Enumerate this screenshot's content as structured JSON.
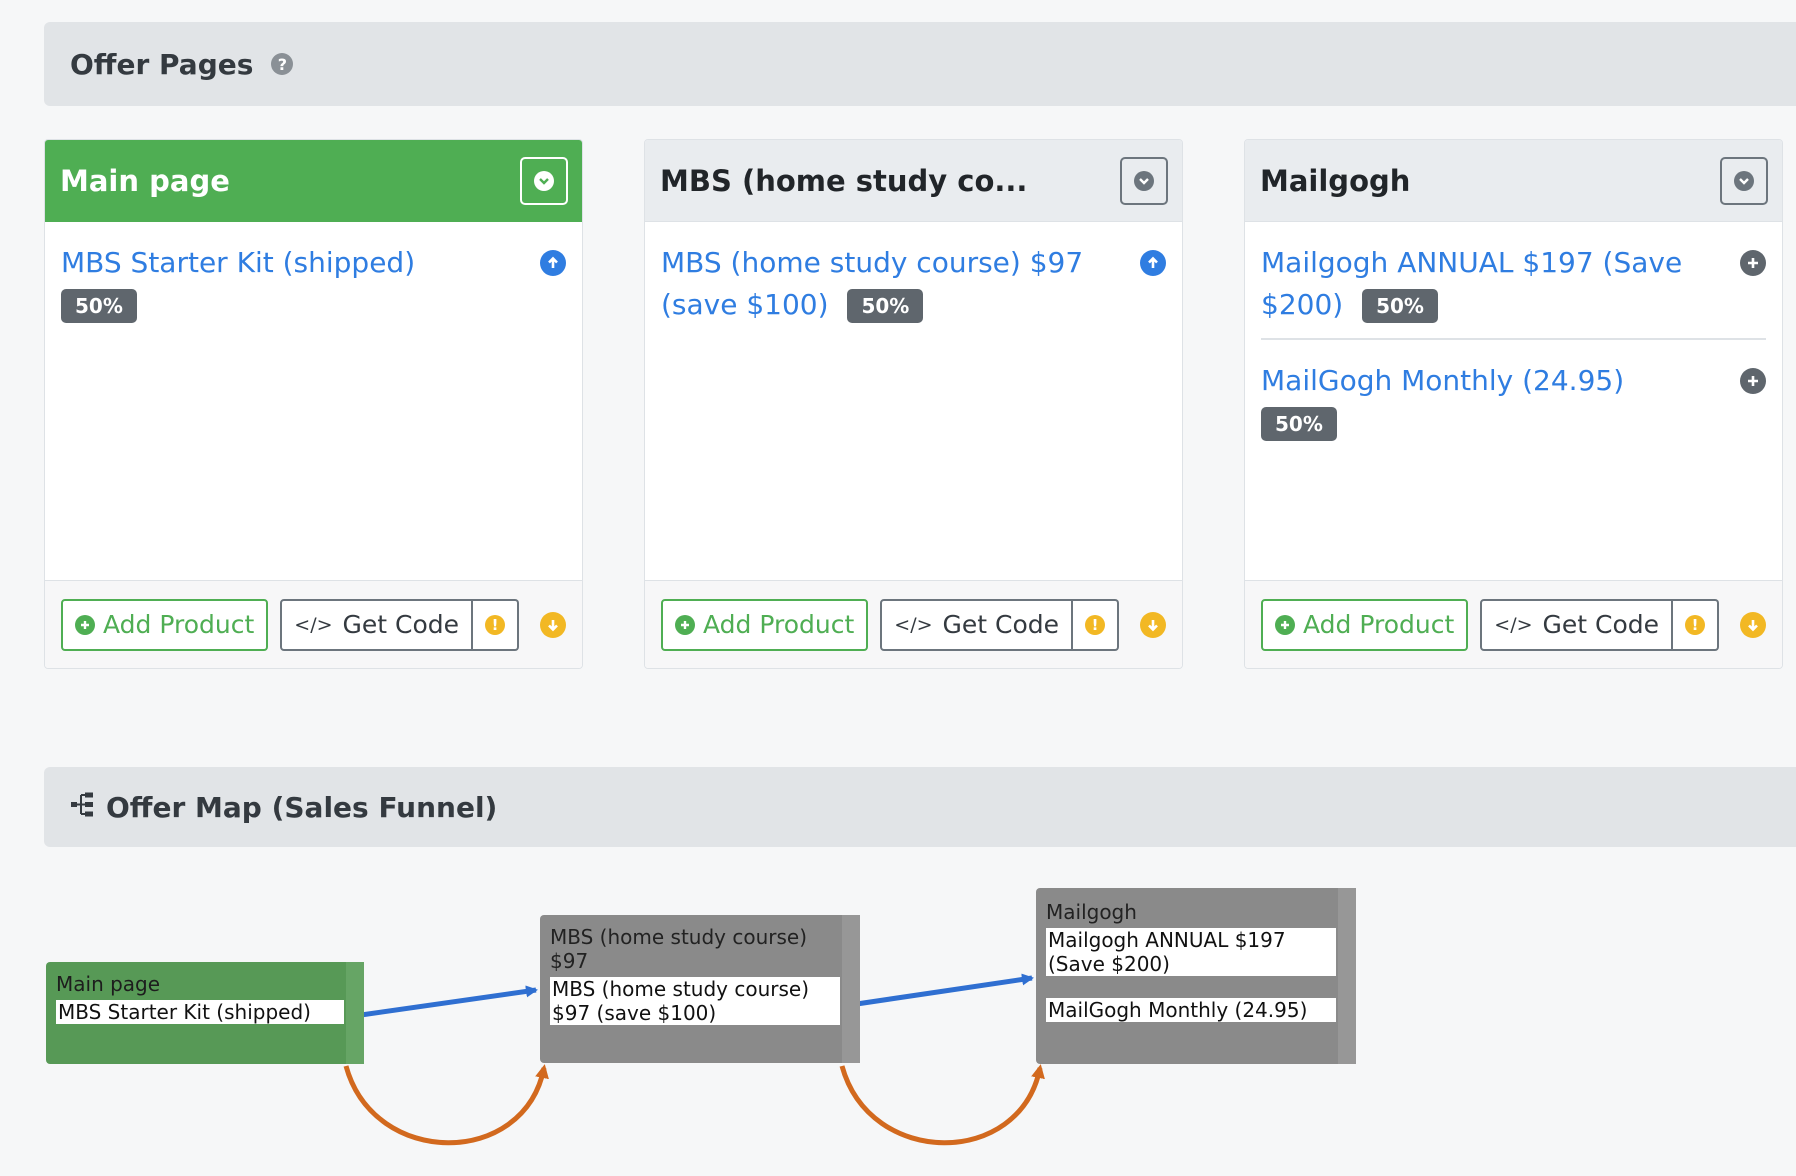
{
  "offer_pages": {
    "title": "Offer Pages",
    "help_icon": "?"
  },
  "cards": [
    {
      "title": "Main page",
      "active": true,
      "products": [
        {
          "name": "MBS Starter Kit (shipped)",
          "badge": "50%",
          "icon": "arrow-up-circle-icon"
        }
      ],
      "add_product": "Add Product",
      "get_code": "Get Code"
    },
    {
      "title": "MBS (home study co...",
      "active": false,
      "products": [
        {
          "name": "MBS (home study course) $97 (save $100)",
          "badge": "50%",
          "icon": "arrow-up-circle-icon"
        }
      ],
      "add_product": "Add Product",
      "get_code": "Get Code"
    },
    {
      "title": "Mailgogh",
      "active": false,
      "products": [
        {
          "name": "Mailgogh ANNUAL $197 (Save $200)",
          "badge": "50%",
          "icon": "plus-circle-icon"
        },
        {
          "name": "MailGogh Monthly (24.95)",
          "badge": "50%",
          "icon": "plus-circle-icon"
        }
      ],
      "add_product": "Add Product",
      "get_code": "Get Code"
    }
  ],
  "offer_map": {
    "title": "Offer Map (Sales Funnel)",
    "nodes": [
      {
        "title": "Main page",
        "items": [
          "MBS Starter Kit (shipped)"
        ]
      },
      {
        "title": "MBS (home study course) $97",
        "items": [
          "MBS (home study course) $97 (save $100)"
        ]
      },
      {
        "title": "Mailgogh",
        "items": [
          "Mailgogh ANNUAL $197 (Save $200)",
          "MailGogh Monthly (24.95)"
        ]
      }
    ]
  },
  "colors": {
    "accent_green": "#4fae53",
    "link_blue": "#2f7de1",
    "badge_gray": "#5f666d",
    "warning_yellow": "#f2b824",
    "funnel_forward": "#2f6fd1",
    "funnel_back": "#d2691e"
  }
}
